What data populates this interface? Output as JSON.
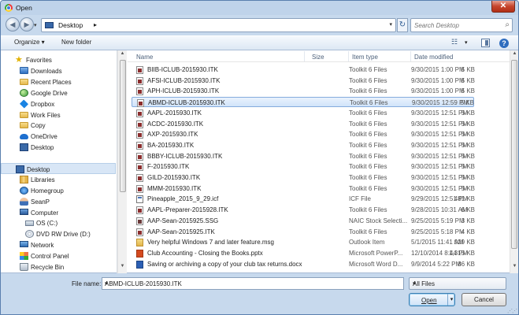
{
  "window": {
    "title": "Open",
    "close_glyph": "✕"
  },
  "address": {
    "location": "Desktop",
    "search_placeholder": "Search Desktop"
  },
  "toolbar": {
    "organize_label": "Organize ▾",
    "new_folder_label": "New folder"
  },
  "nav": {
    "items": [
      {
        "label": "Favorites",
        "icon": "star-icon"
      },
      {
        "label": "Downloads",
        "icon": "downloads-folder-icon"
      },
      {
        "label": "Recent Places",
        "icon": "recent-places-icon"
      },
      {
        "label": "Google Drive",
        "icon": "google-drive-icon"
      },
      {
        "label": "Dropbox",
        "icon": "dropbox-icon"
      },
      {
        "label": "Work Files",
        "icon": "folder-icon"
      },
      {
        "label": "Copy",
        "icon": "folder-icon"
      },
      {
        "label": "OneDrive",
        "icon": "onedrive-icon"
      },
      {
        "label": "Desktop",
        "icon": "desktop-icon"
      },
      {
        "label": "Desktop",
        "icon": "desktop-icon"
      },
      {
        "label": "Libraries",
        "icon": "libraries-icon"
      },
      {
        "label": "Homegroup",
        "icon": "homegroup-icon"
      },
      {
        "label": "SeanP",
        "icon": "user-icon"
      },
      {
        "label": "Computer",
        "icon": "computer-icon"
      },
      {
        "label": "OS (C:)",
        "icon": "drive-icon"
      },
      {
        "label": "DVD RW Drive (D:)",
        "icon": "dvd-drive-icon"
      },
      {
        "label": "Network",
        "icon": "network-icon"
      },
      {
        "label": "Control Panel",
        "icon": "control-panel-icon"
      },
      {
        "label": "Recycle Bin",
        "icon": "recycle-bin-icon"
      }
    ]
  },
  "columns": {
    "name": "Name",
    "size": "Size",
    "type": "Item type",
    "date": "Date modified"
  },
  "files": [
    {
      "name": "BIIB-ICLUB-2015930.ITK",
      "size": "5 KB",
      "type": "Toolkit 6 Files",
      "date": "9/30/2015 1:00 PM",
      "kind": "itk"
    },
    {
      "name": "AFSI-ICLUB-2015930.ITK",
      "size": "5 KB",
      "type": "Toolkit 6 Files",
      "date": "9/30/2015 1:00 PM",
      "kind": "itk"
    },
    {
      "name": "APH-ICLUB-2015930.ITK",
      "size": "5 KB",
      "type": "Toolkit 6 Files",
      "date": "9/30/2015 1:00 PM",
      "kind": "itk"
    },
    {
      "name": "ABMD-ICLUB-2015930.ITK",
      "size": "5 KB",
      "type": "Toolkit 6 Files",
      "date": "9/30/2015 12:59 PM",
      "kind": "itk"
    },
    {
      "name": "AAPL-2015930.ITK",
      "size": "5 KB",
      "type": "Toolkit 6 Files",
      "date": "9/30/2015 12:51 PM",
      "kind": "itk"
    },
    {
      "name": "ACDC-2015930.ITK",
      "size": "5 KB",
      "type": "Toolkit 6 Files",
      "date": "9/30/2015 12:51 PM",
      "kind": "itk"
    },
    {
      "name": "AXP-2015930.ITK",
      "size": "5 KB",
      "type": "Toolkit 6 Files",
      "date": "9/30/2015 12:51 PM",
      "kind": "itk"
    },
    {
      "name": "BA-2015930.ITK",
      "size": "5 KB",
      "type": "Toolkit 6 Files",
      "date": "9/30/2015 12:51 PM",
      "kind": "itk"
    },
    {
      "name": "BBBY-ICLUB-2015930.ITK",
      "size": "5 KB",
      "type": "Toolkit 6 Files",
      "date": "9/30/2015 12:51 PM",
      "kind": "itk"
    },
    {
      "name": "F-2015930.ITK",
      "size": "5 KB",
      "type": "Toolkit 6 Files",
      "date": "9/30/2015 12:51 PM",
      "kind": "itk"
    },
    {
      "name": "GILD-2015930.ITK",
      "size": "5 KB",
      "type": "Toolkit 6 Files",
      "date": "9/30/2015 12:51 PM",
      "kind": "itk"
    },
    {
      "name": "MMM-2015930.ITK",
      "size": "5 KB",
      "type": "Toolkit 6 Files",
      "date": "9/30/2015 12:51 PM",
      "kind": "itk"
    },
    {
      "name": "Pineapple_2015_9_29.icf",
      "size": "481 KB",
      "type": "ICF File",
      "date": "9/29/2015 12:51 PM",
      "kind": "ics"
    },
    {
      "name": "AAPL-Preparer-2015928.ITK",
      "size": "6 KB",
      "type": "Toolkit 6 Files",
      "date": "9/28/2015 10:31 AM",
      "kind": "itk"
    },
    {
      "name": "AAP-Sean-2015925.SSG",
      "size": "3 KB",
      "type": "NAIC Stock Selecti...",
      "date": "9/25/2015 5:19 PM",
      "kind": "ssg"
    },
    {
      "name": "AAP-Sean-2015925.ITK",
      "size": "4 KB",
      "type": "Toolkit 6 Files",
      "date": "9/25/2015 5:18 PM",
      "kind": "itk"
    },
    {
      "name": "Very helpful Windows 7 and later feature.msg",
      "size": "929 KB",
      "type": "Outlook Item",
      "date": "5/1/2015 11:41 AM",
      "kind": "msg"
    },
    {
      "name": "Club Accounting - Closing the Books.pptx",
      "size": "1,315 KB",
      "type": "Microsoft PowerP...",
      "date": "12/10/2014 8:44 PM",
      "kind": "pptx"
    },
    {
      "name": "Saving or archiving a copy of your club tax returns.docx",
      "size": "86 KB",
      "type": "Microsoft Word D...",
      "date": "9/9/2014 5:22 PM",
      "kind": "docx"
    }
  ],
  "selected_file_index": 3,
  "footer": {
    "file_name_label": "File name:",
    "file_name_value": "ABMD-ICLUB-2015930.ITK",
    "filter_value": "All Files",
    "open_label": "Open",
    "cancel_label": "Cancel"
  }
}
